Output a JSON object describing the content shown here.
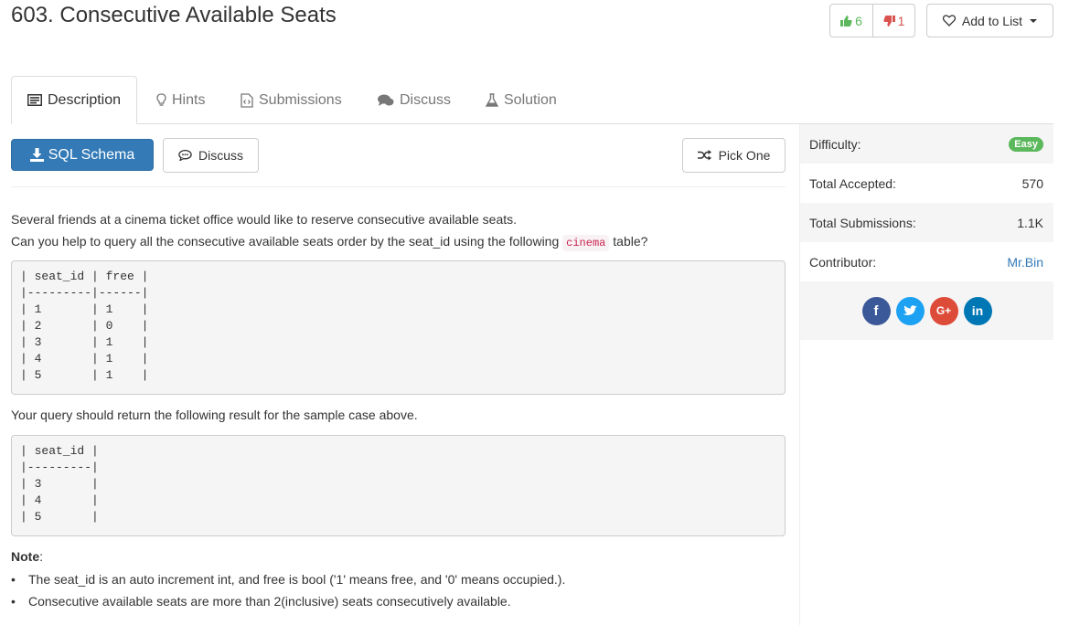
{
  "problem": {
    "title": "603. Consecutive Available Seats"
  },
  "votes": {
    "up": "6",
    "down": "1"
  },
  "add_to_list": {
    "label": "Add to List"
  },
  "tabs": [
    {
      "label": "Description",
      "icon": "description-icon",
      "active": true
    },
    {
      "label": "Hints",
      "icon": "lightbulb-icon"
    },
    {
      "label": "Submissions",
      "icon": "code-file-icon"
    },
    {
      "label": "Discuss",
      "icon": "comments-icon"
    },
    {
      "label": "Solution",
      "icon": "flask-icon"
    }
  ],
  "actions": {
    "sql_schema": "SQL Schema",
    "discuss": "Discuss",
    "pick_one": "Pick One"
  },
  "description": {
    "line1": "Several friends at a cinema ticket office would like to reserve consecutive available seats.",
    "line2_before": "Can you help to query all the consecutive available seats order by the seat_id using the following ",
    "line2_code": "cinema",
    "line2_after": " table?",
    "table1": "| seat_id | free |\n|---------|------|\n| 1       | 1    |\n| 2       | 0    |\n| 3       | 1    |\n| 4       | 1    |\n| 5       | 1    |",
    "return_text": "Your query should return the following result for the sample case above.",
    "table2": "| seat_id |\n|---------|\n| 3       |\n| 4       |\n| 5       |",
    "note_label": "Note",
    "note_colon": ":",
    "notes": [
      "The seat_id is an auto increment int, and free is bool ('1' means free, and '0' means occupied.).",
      "Consecutive available seats are more than 2(inclusive) seats consecutively available."
    ]
  },
  "sidebar": {
    "difficulty_label": "Difficulty:",
    "difficulty_value": "Easy",
    "accepted_label": "Total Accepted:",
    "accepted_value": "570",
    "submissions_label": "Total Submissions:",
    "submissions_value": "1.1K",
    "contributor_label": "Contributor:",
    "contributor_value": "Mr.Bin",
    "social": [
      {
        "name": "facebook-icon",
        "glyph": "f"
      },
      {
        "name": "twitter-icon",
        "glyph": ""
      },
      {
        "name": "google-plus-icon",
        "glyph": "G+"
      },
      {
        "name": "linkedin-icon",
        "glyph": "in"
      }
    ]
  },
  "colors": {
    "primary": "#337ab7",
    "success": "#5cb85c",
    "danger": "#d9534f",
    "code": "#c7254e"
  }
}
